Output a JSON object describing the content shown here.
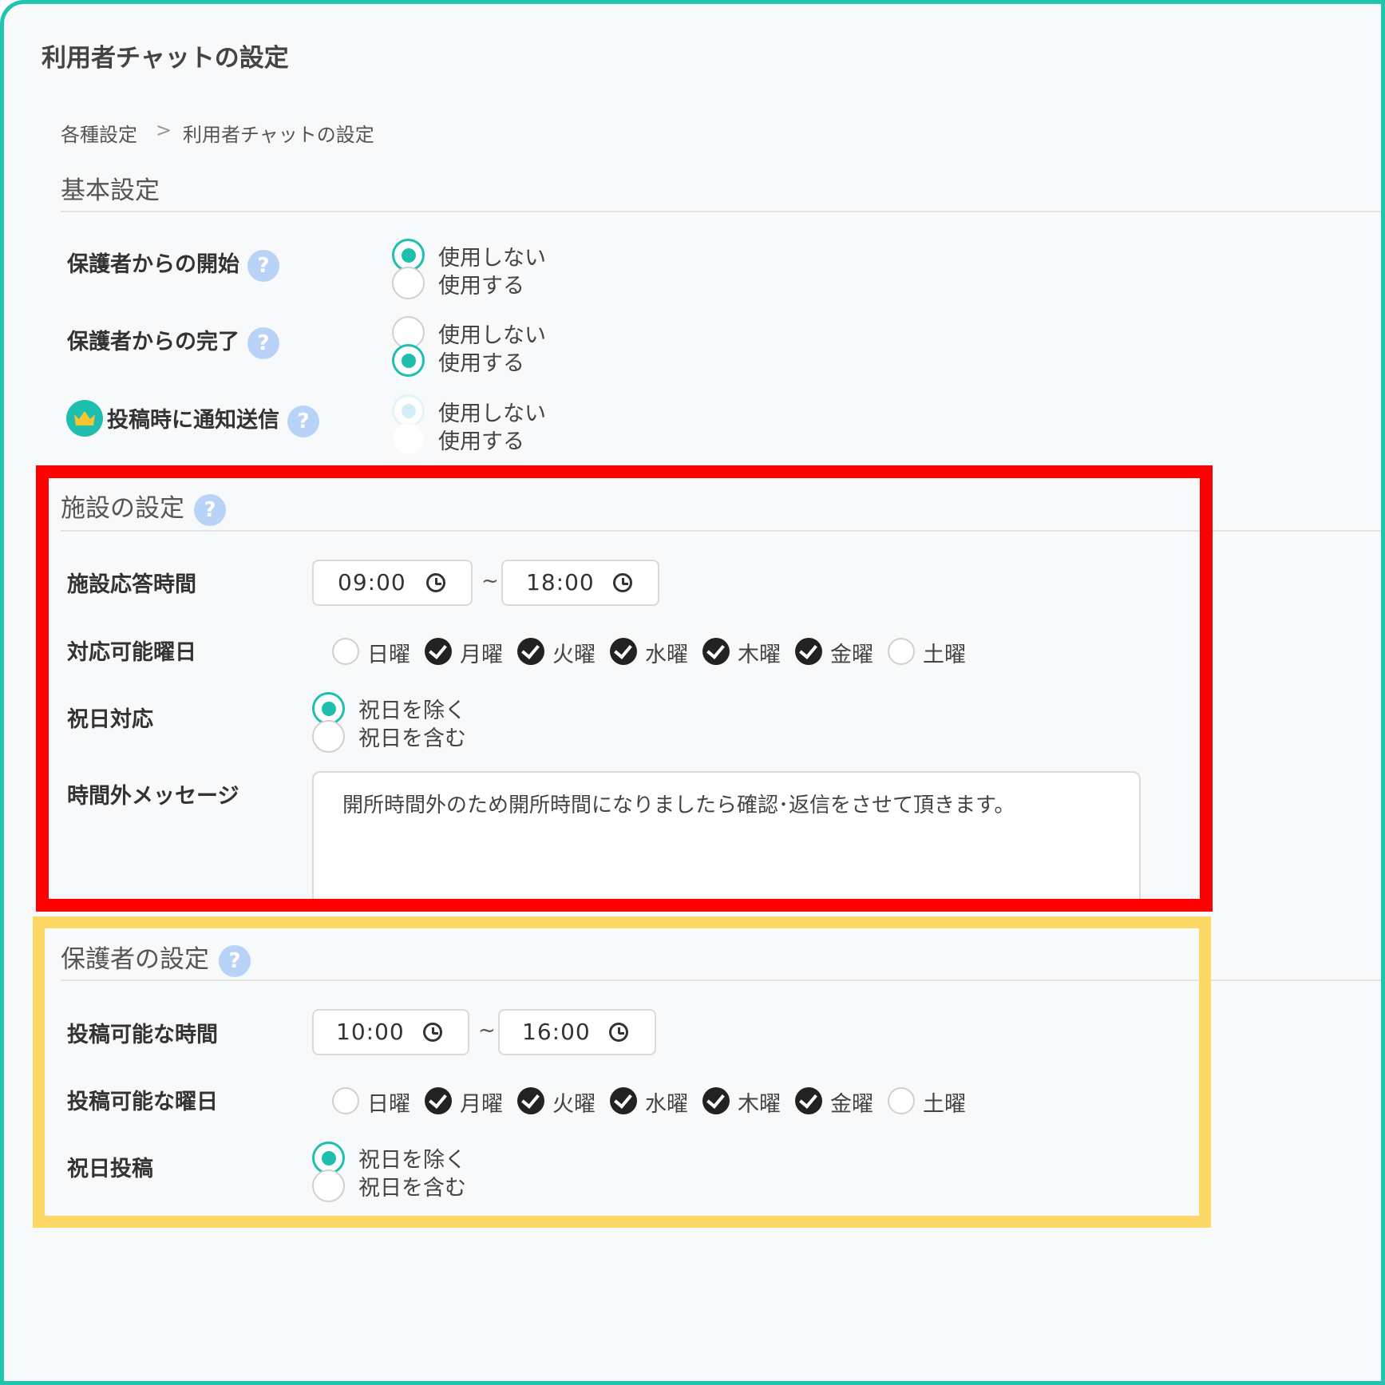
{
  "page": {
    "title": "利用者チャットの設定",
    "breadcrumb": [
      "各種設定",
      ">",
      "利用者チャットの設定"
    ]
  },
  "basic": {
    "title": "基本設定",
    "rows": [
      {
        "label": "保護者からの開始",
        "options": [
          "使用しない",
          "使用する"
        ],
        "selected": 0
      },
      {
        "label": "保護者からの完了",
        "options": [
          "使用しない",
          "使用する"
        ],
        "selected": 1
      },
      {
        "label": "投稿時に通知送信",
        "options": [
          "使用しない",
          "使用する"
        ],
        "selected": 0,
        "disabled": true,
        "icon": "crown-icon"
      }
    ],
    "help": "?"
  },
  "facility": {
    "title": "施設の設定",
    "response_time": {
      "label": "施設応答時間",
      "start": "09:00",
      "end": "18:00",
      "sep": "~"
    },
    "days": {
      "label": "対応可能曜日",
      "items": [
        {
          "name": "日曜",
          "checked": false
        },
        {
          "name": "月曜",
          "checked": true
        },
        {
          "name": "火曜",
          "checked": true
        },
        {
          "name": "水曜",
          "checked": true
        },
        {
          "name": "木曜",
          "checked": true
        },
        {
          "name": "金曜",
          "checked": true
        },
        {
          "name": "土曜",
          "checked": false
        }
      ]
    },
    "holiday": {
      "label": "祝日対応",
      "options": [
        "祝日を除く",
        "祝日を含む"
      ],
      "selected": 0
    },
    "message": {
      "label": "時間外メッセージ",
      "value": "開所時間外のため開所時間になりましたら確認･返信をさせて頂きます。"
    }
  },
  "guardian": {
    "title": "保護者の設定",
    "post_time": {
      "label": "投稿可能な時間",
      "start": "10:00",
      "end": "16:00",
      "sep": "~"
    },
    "days": {
      "label": "投稿可能な曜日",
      "items": [
        {
          "name": "日曜",
          "checked": false
        },
        {
          "name": "月曜",
          "checked": true
        },
        {
          "name": "火曜",
          "checked": true
        },
        {
          "name": "水曜",
          "checked": true
        },
        {
          "name": "木曜",
          "checked": true
        },
        {
          "name": "金曜",
          "checked": true
        },
        {
          "name": "土曜",
          "checked": false
        }
      ]
    },
    "holiday": {
      "label": "祝日投稿",
      "options": [
        "祝日を除く",
        "祝日を含む"
      ],
      "selected": 0
    }
  },
  "colors": {
    "accent": "#1fbfb0",
    "frame": "#22c3b0",
    "highlight_red": "#ff0000",
    "highlight_yellow": "#fed866",
    "help": "#b8d3f7"
  }
}
